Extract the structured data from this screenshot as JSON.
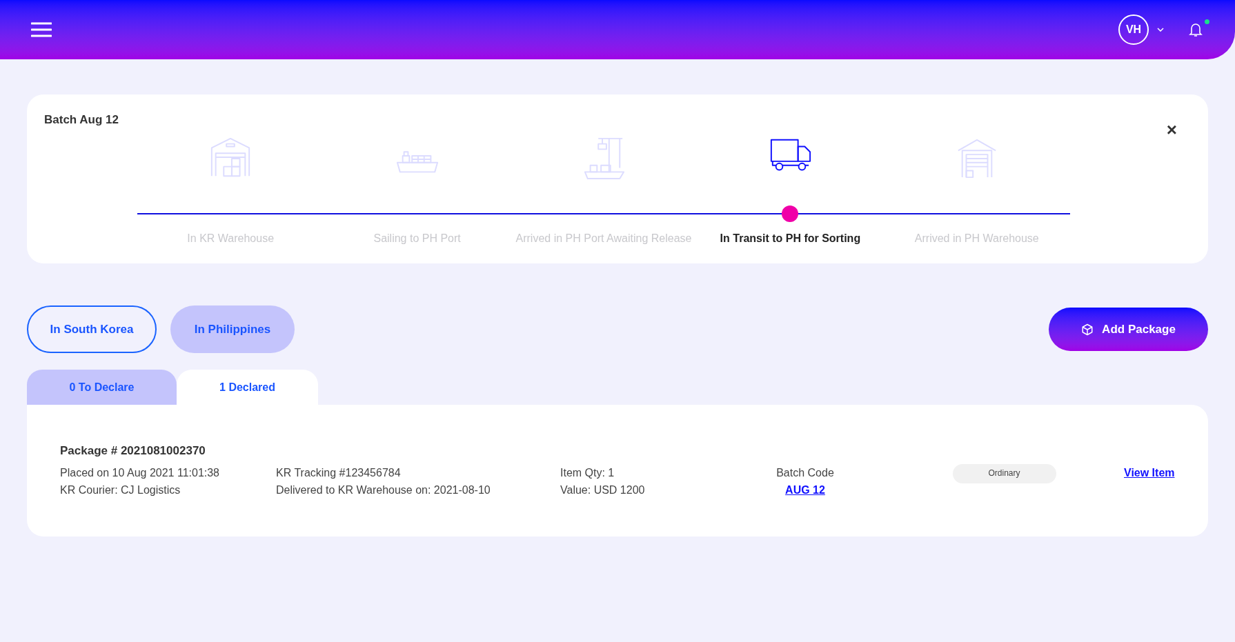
{
  "header": {
    "avatar": "VH",
    "notifications": true
  },
  "batch": {
    "title": "Batch Aug 12",
    "close": "×",
    "steps": [
      {
        "kind": "warehouse",
        "label": "In KR Warehouse",
        "selected": false
      },
      {
        "kind": "ship",
        "label": "Sailing to PH Port",
        "selected": false
      },
      {
        "kind": "port",
        "label": "Arrived in PH Port Awaiting Release",
        "selected": false
      },
      {
        "kind": "truck",
        "label": "In Transit to PH for Sorting",
        "selected": true
      },
      {
        "kind": "storage",
        "label": "Arrived in PH Warehouse",
        "selected": false
      }
    ]
  },
  "location_filters": [
    {
      "label": "In South Korea",
      "selected": true
    },
    {
      "label": "In Philippines",
      "selected": false
    }
  ],
  "add_button": "Add Package",
  "tabs": [
    {
      "label": "0 To Declare",
      "selected": false
    },
    {
      "label": "1 Declared",
      "selected": true
    }
  ],
  "package": {
    "title": "Package # 2021081002370",
    "placed": "Placed on 10 Aug 2021 11:01:38",
    "courier": "KR Courier: CJ Logistics",
    "tracking": "KR Tracking #123456784",
    "delivered": "Delivered to KR Warehouse on: 2021-08-10",
    "qty": "Item Qty: 1",
    "value": "Value: USD 1200",
    "batch_label": "Batch Code",
    "batch_code": "AUG 12",
    "type": "Ordinary",
    "view": "View Item"
  }
}
